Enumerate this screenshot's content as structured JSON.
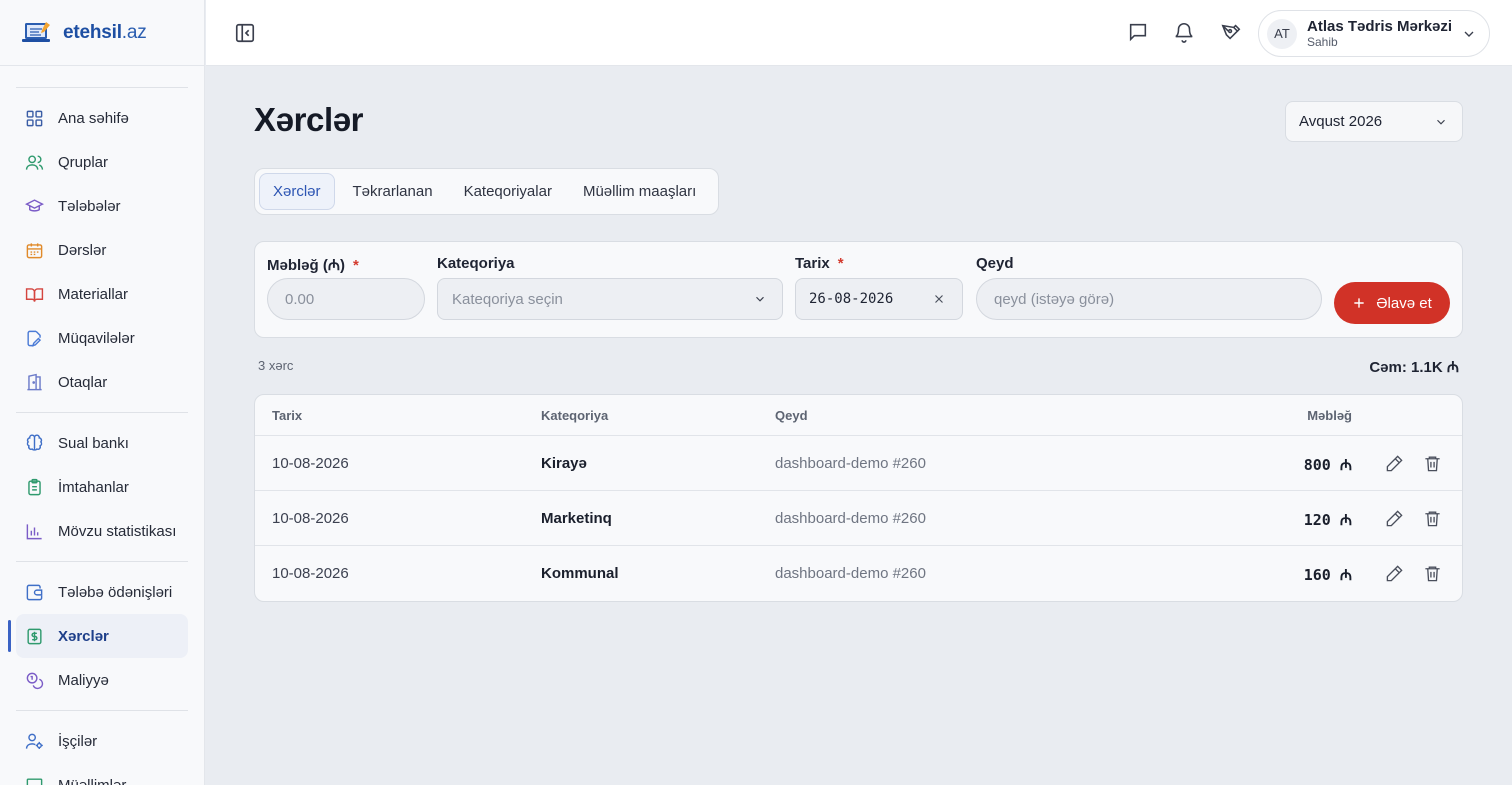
{
  "brand": {
    "name": "etehsil",
    "tld": ".az"
  },
  "sidebar": {
    "groups": [
      [
        {
          "label": "Ana səhifə",
          "icon": "grid-icon"
        },
        {
          "label": "Qruplar",
          "icon": "users-icon"
        },
        {
          "label": "Tələbələr",
          "icon": "graduation-cap-icon"
        },
        {
          "label": "Dərslər",
          "icon": "calendar-icon"
        },
        {
          "label": "Materiallar",
          "icon": "book-open-icon"
        },
        {
          "label": "Müqavilələr",
          "icon": "file-edit-icon"
        },
        {
          "label": "Otaqlar",
          "icon": "door-icon"
        }
      ],
      [
        {
          "label": "Sual bankı",
          "icon": "brain-icon"
        },
        {
          "label": "İmtahanlar",
          "icon": "clipboard-list-icon"
        },
        {
          "label": "Mövzu statistikası",
          "icon": "bar-chart-icon"
        }
      ],
      [
        {
          "label": "Tələbə ödənişləri",
          "icon": "wallet-icon"
        },
        {
          "label": "Xərclər",
          "icon": "dollar-receipt-icon",
          "active": true
        },
        {
          "label": "Maliyyə",
          "icon": "coins-icon"
        }
      ],
      [
        {
          "label": "İşçilər",
          "icon": "user-cog-icon"
        },
        {
          "label": "Müəllimlər",
          "icon": "teacher-icon"
        }
      ]
    ]
  },
  "topbar": {
    "user_initials": "AT",
    "user_name": "Atlas Tədris Mərkəzi",
    "user_role": "Sahib"
  },
  "page": {
    "title": "Xərclər",
    "month": "Avqust 2026",
    "tabs": [
      "Xərclər",
      "Təkrarlanan",
      "Kateqoriyalar",
      "Müəllim maaşları"
    ],
    "active_tab": 0
  },
  "form": {
    "amount_label": "Məbləğ (₼)",
    "amount_placeholder": "0.00",
    "category_label": "Kateqoriya",
    "category_placeholder": "Kateqoriya seçin",
    "date_label": "Tarix",
    "date_value": "26-08-2026",
    "note_label": "Qeyd",
    "note_placeholder": "qeyd (istəyə görə)",
    "required_mark": "*",
    "add_label": "Əlavə et"
  },
  "summary": {
    "count": "3 xərc",
    "total": "Cəm: 1.1K ₼"
  },
  "table": {
    "headers": {
      "date": "Tarix",
      "category": "Kateqoriya",
      "note": "Qeyd",
      "amount": "Məbləğ"
    },
    "rows": [
      {
        "date": "10-08-2026",
        "category": "Kirayə",
        "note": "dashboard-demo #260",
        "amount": "800 ₼"
      },
      {
        "date": "10-08-2026",
        "category": "Marketinq",
        "note": "dashboard-demo #260",
        "amount": "120 ₼"
      },
      {
        "date": "10-08-2026",
        "category": "Kommunal",
        "note": "dashboard-demo #260",
        "amount": "160 ₼"
      }
    ]
  },
  "colors": {
    "accent": "#2d55b3",
    "danger": "#d13227",
    "brand": "#1e4fa3"
  }
}
